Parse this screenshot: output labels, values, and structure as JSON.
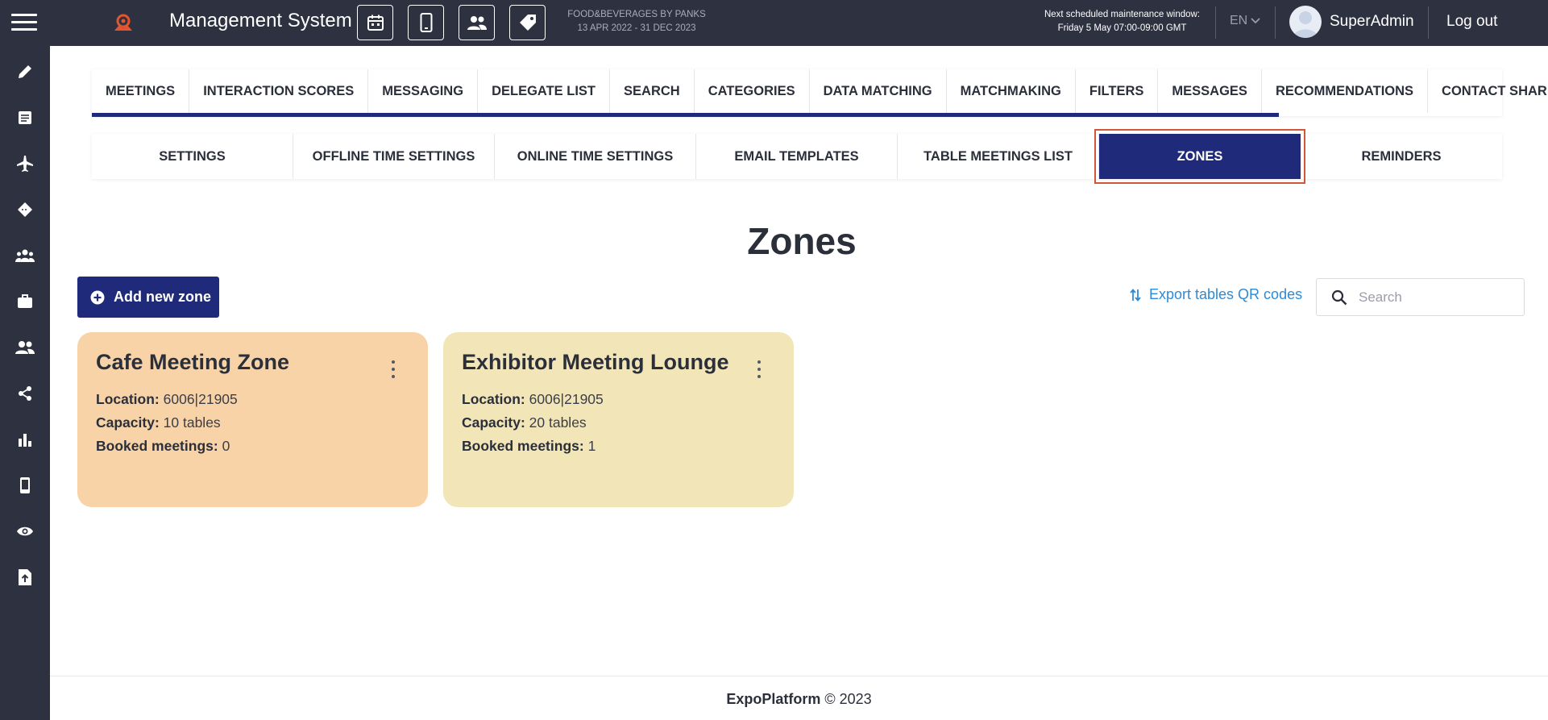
{
  "header": {
    "app_title": "Management System",
    "event_name": "FOOD&BEVERAGES BY PANKS",
    "event_dates": "13 APR 2022 - 31 DEC 2023",
    "maintenance_label": "Next scheduled maintenance window:",
    "maintenance_time": "Friday 5 May 07:00-09:00 GMT",
    "language": "EN",
    "username": "SuperAdmin",
    "logout": "Log out",
    "quick_icons": [
      "calendar-icon",
      "mobile-icon",
      "people-icon",
      "tag-icon"
    ]
  },
  "sidebar": {
    "items": [
      "pencil-icon",
      "list-icon",
      "plane-icon",
      "ticket-icon",
      "group-icon",
      "briefcase-icon",
      "users-icon",
      "share-icon",
      "bar-chart-icon",
      "mobile-icon",
      "eye-icon",
      "file-upload-icon"
    ]
  },
  "main_tabs": [
    "MEETINGS",
    "INTERACTION SCORES",
    "MESSAGING",
    "DELEGATE LIST",
    "SEARCH",
    "CATEGORIES",
    "DATA MATCHING",
    "MATCHMAKING",
    "FILTERS",
    "MESSAGES",
    "RECOMMENDATIONS",
    "CONTACT SHARING"
  ],
  "sub_tabs": [
    "SETTINGS",
    "OFFLINE TIME SETTINGS",
    "ONLINE TIME SETTINGS",
    "EMAIL TEMPLATES",
    "TABLE MEETINGS LIST",
    "ZONES",
    "REMINDERS"
  ],
  "active_sub_tab": "ZONES",
  "page": {
    "title": "Zones",
    "add_button": "Add new zone",
    "export_link": "Export tables QR codes",
    "search_placeholder": "Search"
  },
  "zones": [
    {
      "name": "Cafe Meeting Zone",
      "location_label": "Location:",
      "location": "6006|21905",
      "capacity_label": "Capacity:",
      "capacity": "10 tables",
      "booked_label": "Booked meetings:",
      "booked": "0",
      "color": "#f8d3a8"
    },
    {
      "name": "Exhibitor Meeting Lounge",
      "location_label": "Location:",
      "location": "6006|21905",
      "capacity_label": "Capacity:",
      "capacity": "20 tables",
      "booked_label": "Booked meetings:",
      "booked": "1",
      "color": "#f2e6b8"
    }
  ],
  "footer": {
    "brand": "ExpoPlatform",
    "copyright": "© 2023"
  },
  "colors": {
    "topbar": "#2e3140",
    "primary": "#1f2a7a",
    "active_outline": "#d4563a",
    "link": "#2d8ad6"
  }
}
